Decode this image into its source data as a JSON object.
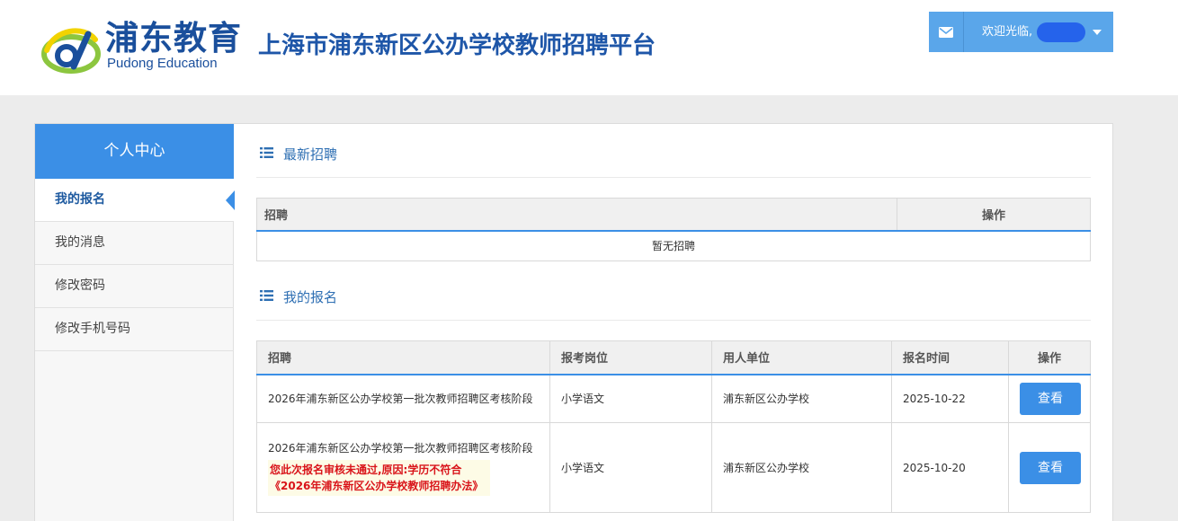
{
  "header": {
    "logo_cn": "浦东教育",
    "logo_en": "Pudong Education",
    "site_title": "上海市浦东新区公办学校教师招聘平台",
    "welcome": "欢迎光临,",
    "mail_icon": "envelope-icon",
    "menu_icon": "caret-down-icon",
    "accent_color": "#5aa6ea"
  },
  "sidebar": {
    "title": "个人中心",
    "items": [
      {
        "label": "我的报名",
        "active": true
      },
      {
        "label": "我的消息",
        "active": false
      },
      {
        "label": "修改密码",
        "active": false
      },
      {
        "label": "修改手机号码",
        "active": false
      }
    ]
  },
  "latest": {
    "title": "最新招聘",
    "icon": "list-icon",
    "columns": [
      "招聘",
      "操作"
    ],
    "empty_text": "暂无招聘"
  },
  "mine": {
    "title": "我的报名",
    "icon": "list-icon",
    "columns": [
      "招聘",
      "报考岗位",
      "用人单位",
      "报名时间",
      "操作"
    ],
    "rows": [
      {
        "recruit": "2026年浦东新区公办学校第一批次教师招聘区考核阶段",
        "position": "小学语文",
        "unit": "浦东新区公办学校",
        "date": "2025-10-22",
        "action": "查看",
        "notice_line1": "",
        "notice_line2": ""
      },
      {
        "recruit": "2026年浦东新区公办学校第一批次教师招聘区考核阶段",
        "position": "小学语文",
        "unit": "浦东新区公办学校",
        "date": "2025-10-20",
        "action": "查看",
        "notice_line1": "您此次报名审核未通过,原因:学历不符合",
        "notice_line2": "《2026年浦东新区公办学校教师招聘办法》"
      }
    ]
  },
  "colors": {
    "primary": "#3b8fe6",
    "title_blue": "#1e56a8",
    "reject_red": "#d9141a"
  }
}
